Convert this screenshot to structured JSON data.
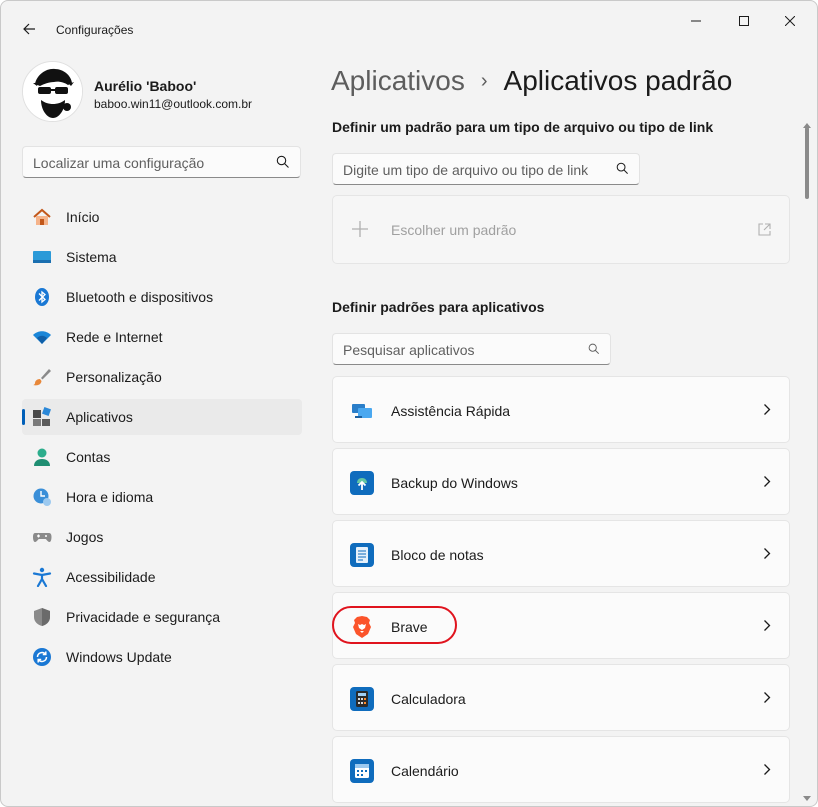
{
  "window": {
    "title": "Configurações"
  },
  "profile": {
    "name": "Aurélio 'Baboo'",
    "email": "baboo.win11@outlook.com.br"
  },
  "sidebar": {
    "search_placeholder": "Localizar uma configuração",
    "items": [
      {
        "label": "Início",
        "icon": "home-icon"
      },
      {
        "label": "Sistema",
        "icon": "system-icon"
      },
      {
        "label": "Bluetooth e dispositivos",
        "icon": "bluetooth-icon"
      },
      {
        "label": "Rede e Internet",
        "icon": "wifi-icon"
      },
      {
        "label": "Personalização",
        "icon": "brush-icon"
      },
      {
        "label": "Aplicativos",
        "icon": "apps-icon",
        "active": true
      },
      {
        "label": "Contas",
        "icon": "account-icon"
      },
      {
        "label": "Hora e idioma",
        "icon": "clock-globe-icon"
      },
      {
        "label": "Jogos",
        "icon": "gamepad-icon"
      },
      {
        "label": "Acessibilidade",
        "icon": "accessibility-icon"
      },
      {
        "label": "Privacidade e segurança",
        "icon": "shield-icon"
      },
      {
        "label": "Windows Update",
        "icon": "update-icon"
      }
    ]
  },
  "breadcrumb": {
    "parent": "Aplicativos",
    "separator": "›",
    "current": "Aplicativos padrão"
  },
  "file_type_section": {
    "title": "Definir um padrão para um tipo de arquivo ou tipo de link",
    "search_placeholder": "Digite um tipo de arquivo ou tipo de link",
    "choose_label": "Escolher um padrão"
  },
  "apps_section": {
    "title": "Definir padrões para aplicativos",
    "search_placeholder": "Pesquisar aplicativos",
    "apps": [
      {
        "name": "Assistência Rápida",
        "icon": "quick-assist-icon"
      },
      {
        "name": "Backup do Windows",
        "icon": "windows-backup-icon"
      },
      {
        "name": "Bloco de notas",
        "icon": "notepad-icon"
      },
      {
        "name": "Brave",
        "icon": "brave-icon",
        "highlighted": true
      },
      {
        "name": "Calculadora",
        "icon": "calculator-icon"
      },
      {
        "name": "Calendário",
        "icon": "calendar-icon"
      }
    ]
  },
  "colors": {
    "accent": "#005fb8",
    "highlight_ring": "#e0141e",
    "background": "#f3f3f3"
  }
}
